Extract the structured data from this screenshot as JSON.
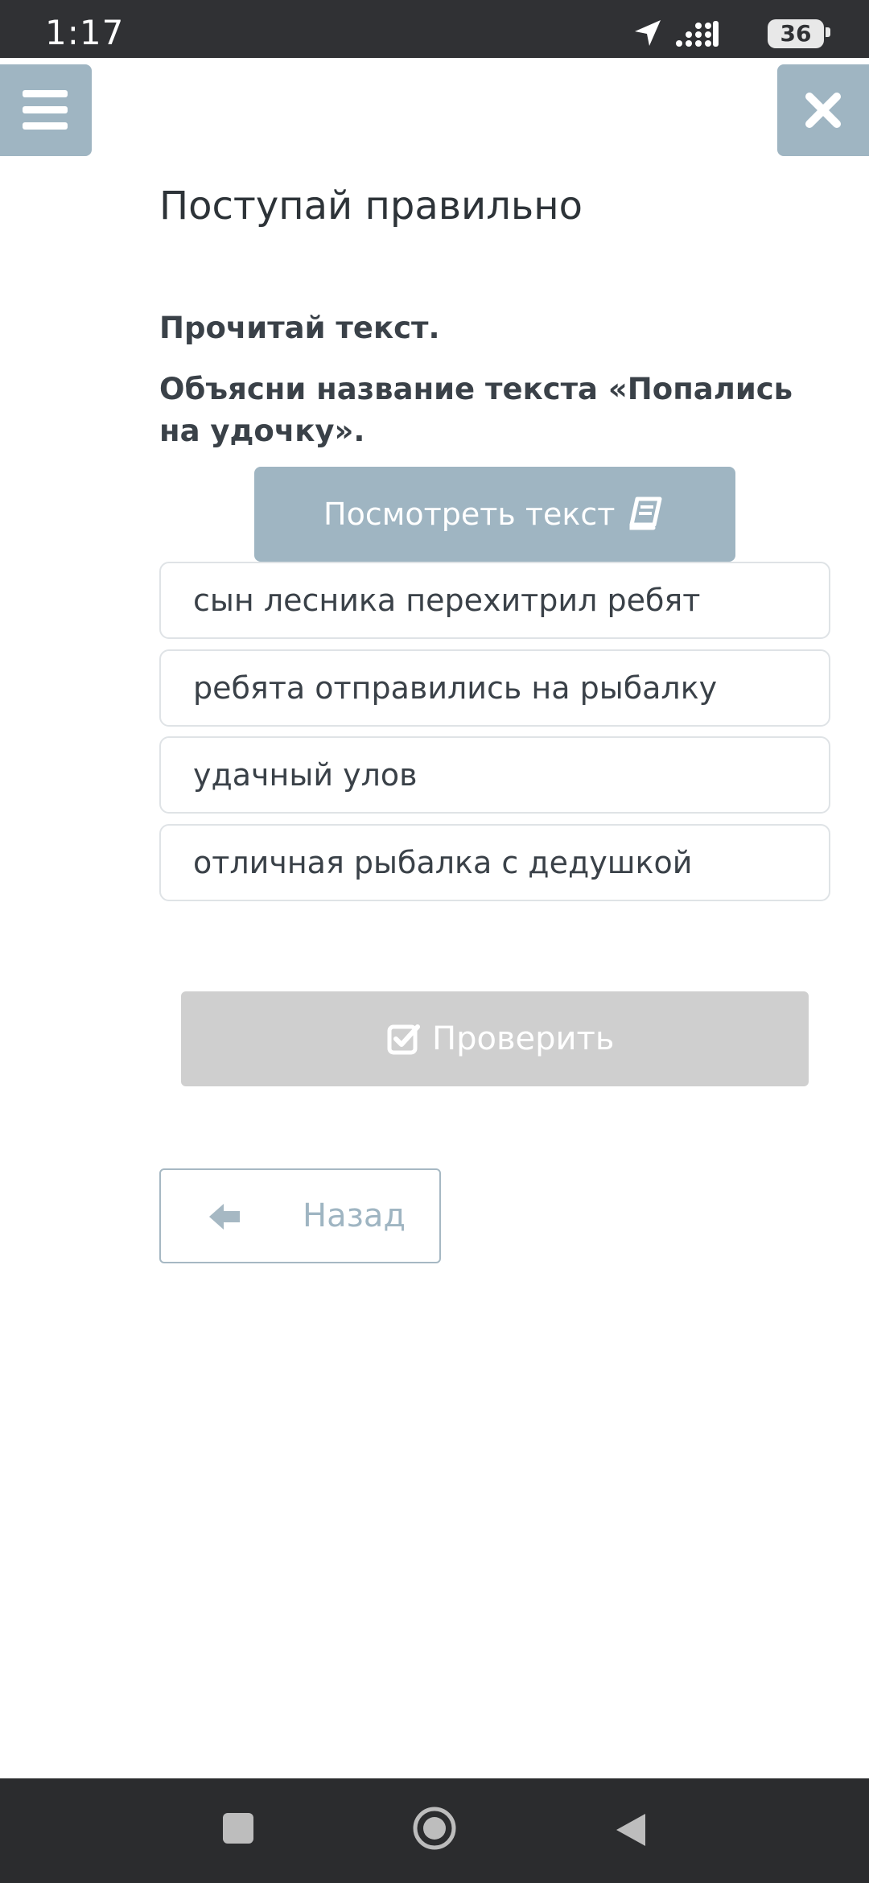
{
  "status_bar": {
    "time": "1:17",
    "battery": "36"
  },
  "header": {
    "menu_icon": "hamburger-icon",
    "close_icon": "close-icon"
  },
  "page": {
    "title": "Поступай правильно",
    "instruction": "Прочитай текст.",
    "question": "Объясни название текста «Попались на удочку».",
    "view_text_button": "Посмотреть текст",
    "view_text_icon": "book-icon"
  },
  "options": [
    "сын лесника перехитрил ребят",
    "ребята отправились на рыбалку",
    "удачный улов",
    "отличная рыбалка с дедушкой"
  ],
  "actions": {
    "check_button": "Проверить",
    "check_icon": "check-square-icon",
    "back_button": "Назад",
    "back_icon": "arrow-left-icon"
  },
  "colors": {
    "accent": "#9fb5c2",
    "disabled": "#cfcfcf",
    "status_bar": "#303134",
    "nav_bar": "#2b2c2e"
  },
  "nav_bar": {
    "recents_icon": "square-icon",
    "home_icon": "circle-icon",
    "back_icon": "triangle-back-icon"
  }
}
